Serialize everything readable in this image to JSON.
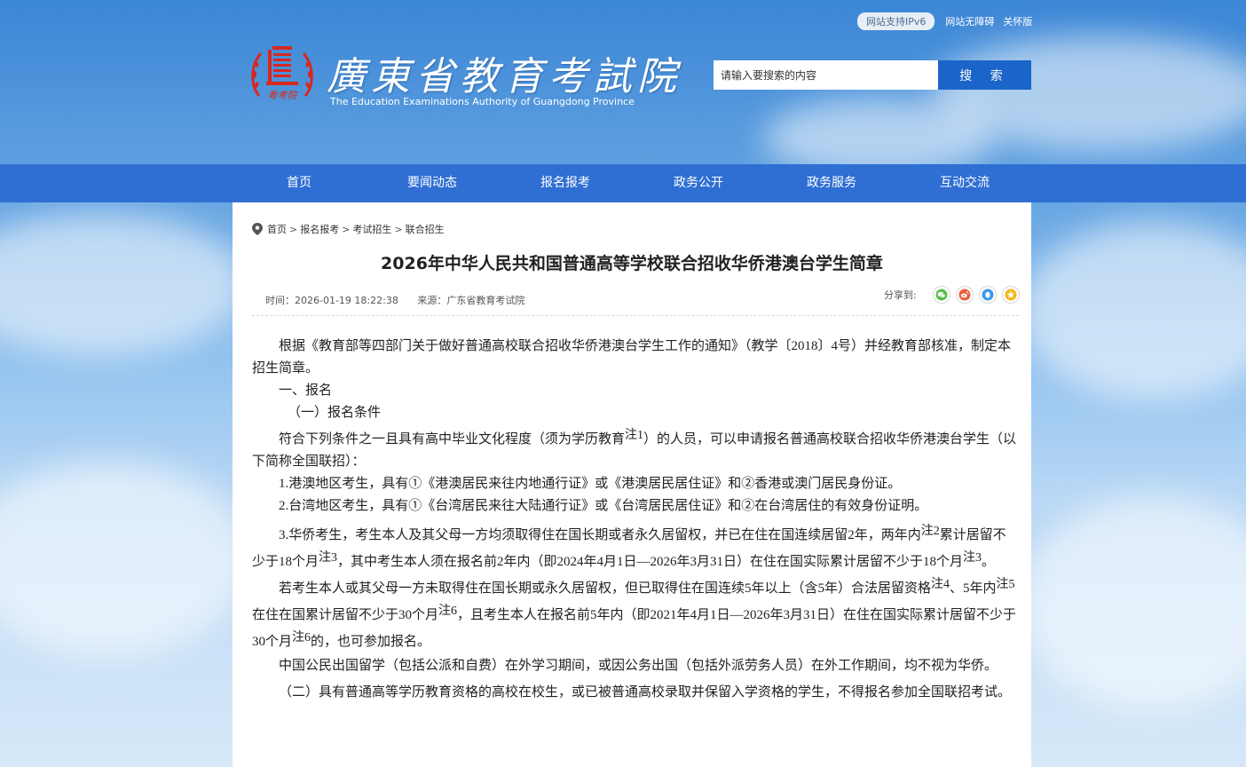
{
  "header": {
    "ipv6_label": "网站支持IPv6",
    "accessibility_link": "网站无障碍",
    "elder_link": "关怀版",
    "site_title_cn": "廣東省教育考試院",
    "site_title_en": "The Education Examinations Authority of Guangdong Province",
    "logo_text": "粤考院",
    "search_placeholder": "请输入要搜索的内容",
    "search_button": "搜 索"
  },
  "nav": {
    "items": [
      {
        "label": "首页"
      },
      {
        "label": "要闻动态"
      },
      {
        "label": "报名报考"
      },
      {
        "label": "政务公开"
      },
      {
        "label": "政务服务"
      },
      {
        "label": "互动交流"
      }
    ]
  },
  "breadcrumb": [
    "首页",
    "报名报考",
    "考试招生",
    "联合招生"
  ],
  "breadcrumb_sep": ">",
  "article": {
    "title": "2026年中华人民共和国普通高等学校联合招收华侨港澳台学生简章",
    "time": "时间：2026-01-19 18:22:38",
    "source": "来源：广东省教育考试院",
    "share_label": "分享到:",
    "note": "注",
    "n1": "1",
    "n2": "2",
    "n3": "3",
    "n4": "4",
    "n5": "5",
    "n6": "6",
    "p1": "根据《教育部等四部门关于做好普通高校联合招收华侨港澳台学生工作的通知》（教学〔2018〕4号）并经教育部核准，制定本招生简章。",
    "h1": "一、报名",
    "h2": "（一）报名条件",
    "p2a": "符合下列条件之一且具有高中毕业文化程度（须为学历教育",
    "p2b": "）的人员，可以申请报名普通高校联合招收华侨港澳台学生（以下简称全国联招）：",
    "p3": "1.港澳地区考生，具有①《港澳居民来往内地通行证》或《港澳居民居住证》和②香港或澳门居民身份证。",
    "p4": "2.台湾地区考生，具有①《台湾居民来往大陆通行证》或《台湾居民居住证》和②在台湾居住的有效身份证明。",
    "p5a": "3.华侨考生，考生本人及其父母一方均须取得住在国长期或者永久居留权，并已在住在国连续居留2年，两年内",
    "p5b": "累计居留不少于18个月",
    "p5c": "，其中考生本人须在报名前2年内（即2024年4月1日—2026年3月31日）在住在国实际累计居留不少于18个月",
    "p5d": "。",
    "p6a": "若考生本人或其父母一方未取得住在国长期或永久居留权，但已取得住在国连续5年以上（含5年）合法居留资格",
    "p6b": "、5年内",
    "p6c": "在住在国累计居留不少于30个月",
    "p6d": "，且考生本人在报名前5年内（即2021年4月1日—2026年3月31日）在住在国实际累计居留不少于30个月",
    "p6e": "的，也可参加报名。",
    "p7": "中国公民出国留学（包括公派和自费）在外学习期间，或因公务出国（包括外派劳务人员）在外工作期间，均不视为华侨。",
    "p8": "（二）具有普通高等学历教育资格的高校在校生，或已被普通高校录取并保留入学资格的学生，不得报名参加全国联招考试。"
  },
  "colors": {
    "nav_bg": "#2f6fd3",
    "search_btn": "#1b64c9",
    "logo_red": "#d6281f"
  }
}
